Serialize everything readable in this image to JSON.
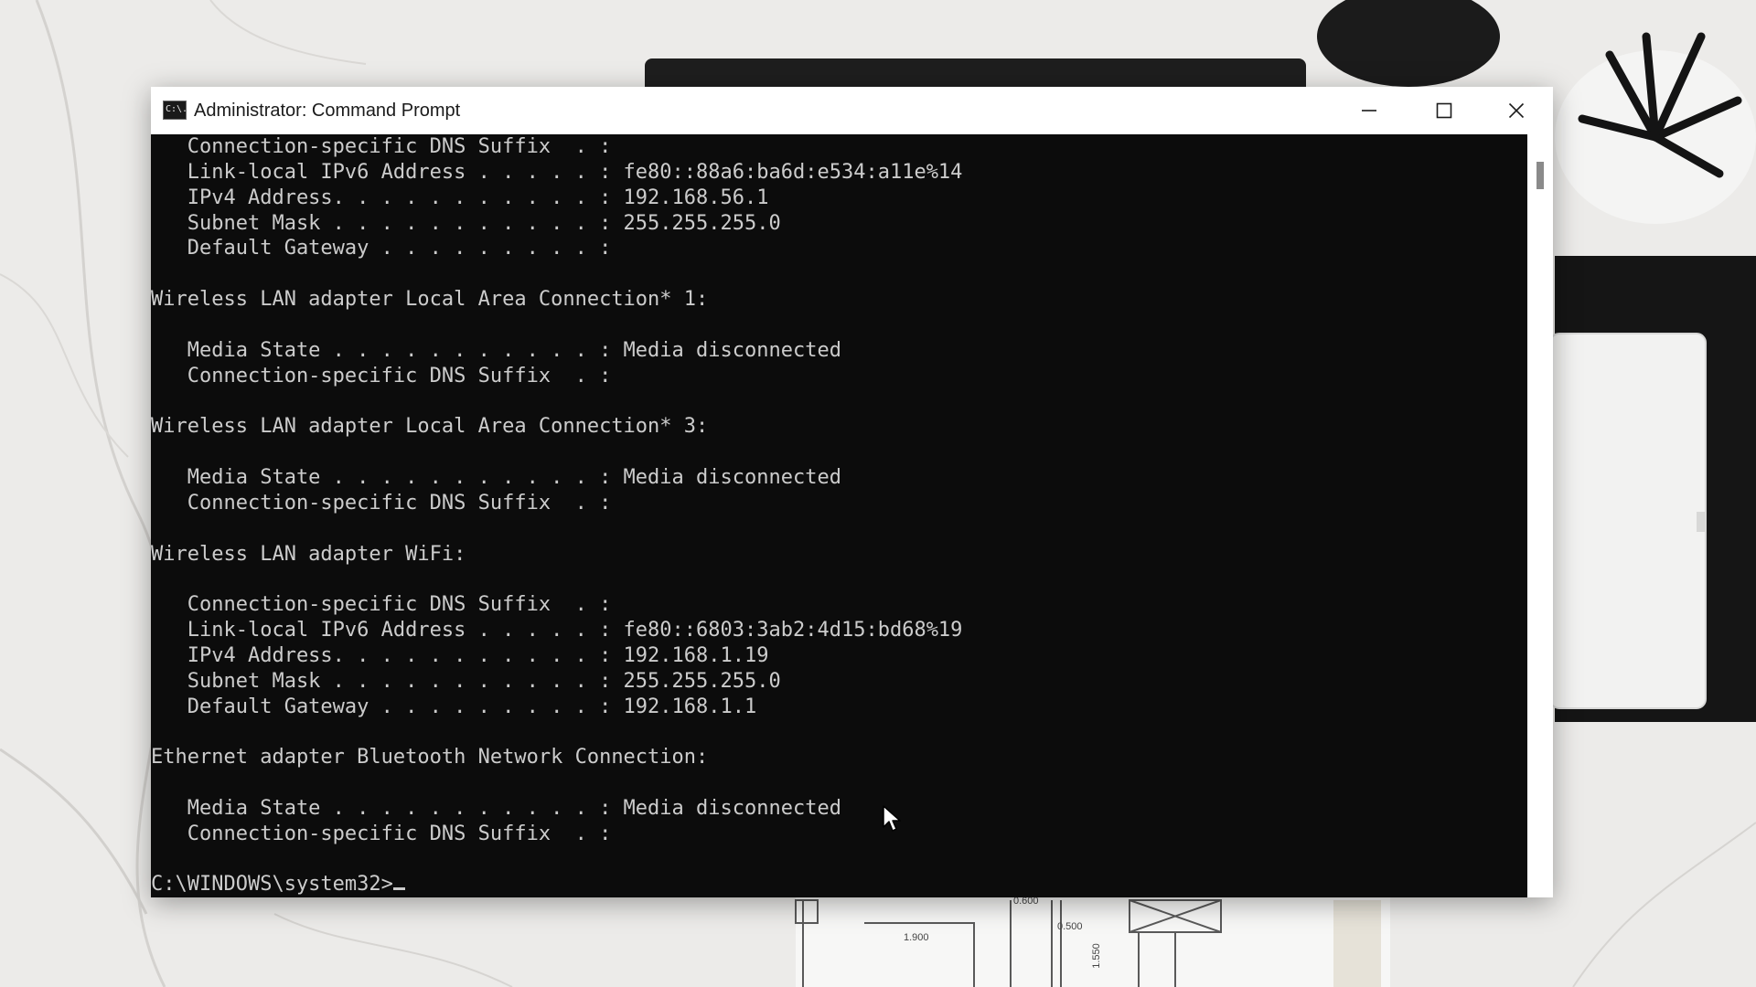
{
  "window": {
    "title": "Administrator: Command Prompt",
    "icon_text": "C:\\."
  },
  "controls": {
    "minimize": "minimize-icon",
    "maximize": "maximize-icon",
    "close": "close-icon"
  },
  "console": {
    "lines": [
      "   Connection-specific DNS Suffix  . :",
      "   Link-local IPv6 Address . . . . . : fe80::88a6:ba6d:e534:a11e%14",
      "   IPv4 Address. . . . . . . . . . . : 192.168.56.1",
      "   Subnet Mask . . . . . . . . . . . : 255.255.255.0",
      "   Default Gateway . . . . . . . . . :",
      "",
      "Wireless LAN adapter Local Area Connection* 1:",
      "",
      "   Media State . . . . . . . . . . . : Media disconnected",
      "   Connection-specific DNS Suffix  . :",
      "",
      "Wireless LAN adapter Local Area Connection* 3:",
      "",
      "   Media State . . . . . . . . . . . : Media disconnected",
      "   Connection-specific DNS Suffix  . :",
      "",
      "Wireless LAN adapter WiFi:",
      "",
      "   Connection-specific DNS Suffix  . :",
      "   Link-local IPv6 Address . . . . . : fe80::6803:3ab2:4d15:bd68%19",
      "   IPv4 Address. . . . . . . . . . . : 192.168.1.19",
      "   Subnet Mask . . . . . . . . . . . : 255.255.255.0",
      "   Default Gateway . . . . . . . . . : 192.168.1.1",
      "",
      "Ethernet adapter Bluetooth Network Connection:",
      "",
      "   Media State . . . . . . . . . . . : Media disconnected",
      "   Connection-specific DNS Suffix  . :",
      ""
    ],
    "prompt": "C:\\WINDOWS\\system32>"
  },
  "background": {
    "blueprint_labels": [
      "0.600",
      "1.900",
      "0.500",
      "1.550"
    ]
  },
  "colors": {
    "console_bg": "#0c0c0c",
    "console_fg": "#cccccc",
    "titlebar_bg": "#ffffff"
  }
}
